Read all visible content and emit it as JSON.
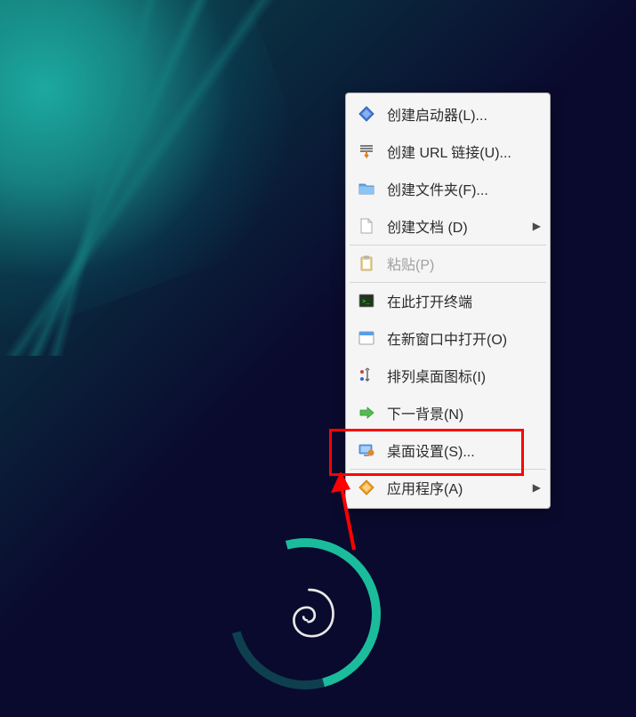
{
  "context_menu": {
    "items": [
      {
        "label": "创建启动器(L)...",
        "icon": "launcher-icon",
        "submenu": false
      },
      {
        "label": "创建 URL 链接(U)...",
        "icon": "url-link-icon",
        "submenu": false
      },
      {
        "label": "创建文件夹(F)...",
        "icon": "folder-icon",
        "submenu": false
      },
      {
        "label": "创建文档 (D)",
        "icon": "document-icon",
        "submenu": true
      },
      {
        "label": "粘贴(P)",
        "icon": "paste-icon",
        "submenu": false,
        "disabled": true
      },
      {
        "label": "在此打开终端",
        "icon": "terminal-icon",
        "submenu": false
      },
      {
        "label": "在新窗口中打开(O)",
        "icon": "window-icon",
        "submenu": false
      },
      {
        "label": "排列桌面图标(I)",
        "icon": "arrange-icon",
        "submenu": false
      },
      {
        "label": "下一背景(N)",
        "icon": "next-arrow-icon",
        "submenu": false
      },
      {
        "label": "桌面设置(S)...",
        "icon": "settings-icon",
        "submenu": false
      },
      {
        "label": "应用程序(A)",
        "icon": "apps-icon",
        "submenu": true
      }
    ]
  },
  "annotation": {
    "highlighted_item_index": 9
  }
}
